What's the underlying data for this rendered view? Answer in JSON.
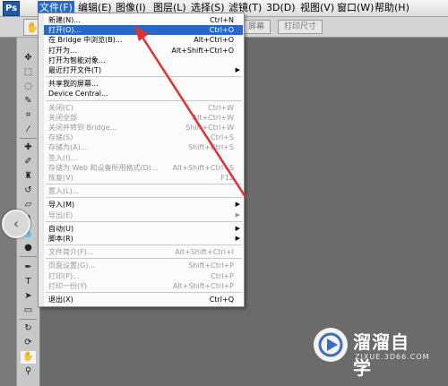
{
  "colors": {
    "highlight": "#2a68c7",
    "annotation_arrow": "#e03030",
    "canvas_bg": "#6b6b6b"
  },
  "menubar": {
    "logo": "Ps",
    "items": [
      "文件(F)",
      "编辑(E)",
      "图像(I)",
      "图层(L)",
      "选择(S)",
      "滤镜(T)",
      "3D(D)",
      "视图(V)",
      "窗口(W)",
      "帮助(H)"
    ]
  },
  "optbar": {
    "hand_icon": "hand-icon",
    "screen_btn": "屏幕",
    "print_size_btn": "打印尺寸"
  },
  "file_menu": {
    "items": [
      {
        "label": "新建(N)...",
        "shortcut": "Ctrl+N",
        "disabled": false,
        "submenu": false
      },
      {
        "label": "打开(O)...",
        "shortcut": "Ctrl+O",
        "disabled": false,
        "submenu": false,
        "highlight": true
      },
      {
        "label": "在 Bridge 中浏览(B)...",
        "shortcut": "Alt+Ctrl+O",
        "disabled": false,
        "submenu": false
      },
      {
        "label": "打开为...",
        "shortcut": "Alt+Shift+Ctrl+O",
        "disabled": false,
        "submenu": false
      },
      {
        "label": "打开为智能对象...",
        "shortcut": "",
        "disabled": false,
        "submenu": false
      },
      {
        "label": "最近打开文件(T)",
        "shortcut": "",
        "disabled": false,
        "submenu": true
      },
      {
        "sep": true
      },
      {
        "label": "共享我的屏幕...",
        "shortcut": "",
        "disabled": false,
        "submenu": false
      },
      {
        "label": "Device Central...",
        "shortcut": "",
        "disabled": false,
        "submenu": false
      },
      {
        "sep": true
      },
      {
        "label": "关闭(C)",
        "shortcut": "Ctrl+W",
        "disabled": true,
        "submenu": false
      },
      {
        "label": "关闭全部",
        "shortcut": "Alt+Ctrl+W",
        "disabled": true,
        "submenu": false
      },
      {
        "label": "关闭并转到 Bridge...",
        "shortcut": "Shift+Ctrl+W",
        "disabled": true,
        "submenu": false
      },
      {
        "label": "存储(S)",
        "shortcut": "Ctrl+S",
        "disabled": true,
        "submenu": false
      },
      {
        "label": "存储为(A)...",
        "shortcut": "Shift+Ctrl+S",
        "disabled": true,
        "submenu": false
      },
      {
        "label": "签入(I)...",
        "shortcut": "",
        "disabled": true,
        "submenu": false
      },
      {
        "label": "存储为 Web 和设备所用格式(D)...",
        "shortcut": "Alt+Shift+Ctrl+S",
        "disabled": true,
        "submenu": false
      },
      {
        "label": "恢复(V)",
        "shortcut": "F12",
        "disabled": true,
        "submenu": false
      },
      {
        "sep": true
      },
      {
        "label": "置入(L)...",
        "shortcut": "",
        "disabled": true,
        "submenu": false
      },
      {
        "sep": true
      },
      {
        "label": "导入(M)",
        "shortcut": "",
        "disabled": false,
        "submenu": true
      },
      {
        "label": "导出(E)",
        "shortcut": "",
        "disabled": true,
        "submenu": true
      },
      {
        "sep": true
      },
      {
        "label": "自动(U)",
        "shortcut": "",
        "disabled": false,
        "submenu": true
      },
      {
        "label": "脚本(R)",
        "shortcut": "",
        "disabled": false,
        "submenu": true
      },
      {
        "sep": true
      },
      {
        "label": "文件简介(F)...",
        "shortcut": "Alt+Shift+Ctrl+I",
        "disabled": true,
        "submenu": false
      },
      {
        "sep": true
      },
      {
        "label": "页面设置(G)...",
        "shortcut": "Shift+Ctrl+P",
        "disabled": true,
        "submenu": false
      },
      {
        "label": "打印(P)...",
        "shortcut": "Ctrl+P",
        "disabled": true,
        "submenu": false
      },
      {
        "label": "打印一份(Y)",
        "shortcut": "Alt+Shift+Ctrl+P",
        "disabled": true,
        "submenu": false
      },
      {
        "sep": true
      },
      {
        "label": "退出(X)",
        "shortcut": "Ctrl+Q",
        "disabled": false,
        "submenu": false
      }
    ]
  },
  "watermark": {
    "title": "溜溜自学",
    "subtitle": "ZIXUE.3D66.COM"
  }
}
